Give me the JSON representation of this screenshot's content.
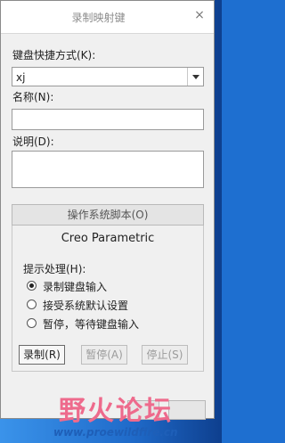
{
  "window": {
    "title": "录制映射键",
    "close_glyph": "×"
  },
  "form": {
    "key_sequence": {
      "label": "键盘快捷方式(K):",
      "value": "xj"
    },
    "name": {
      "label": "名称(N):",
      "value": ""
    },
    "description": {
      "label": "说明(D):",
      "value": ""
    }
  },
  "script_section": {
    "tab_label": "操作系统脚本(O)",
    "app_label": "Creo Parametric",
    "prompt_label": "提示处理(H):",
    "options": [
      {
        "label": "录制键盘输入",
        "selected": true
      },
      {
        "label": "接受系统默认设置",
        "selected": false
      },
      {
        "label": "暂停，等待键盘输入",
        "selected": false
      }
    ],
    "buttons": {
      "record": "录制(R)",
      "pause": "暂停(A)",
      "stop": "停止(S)"
    }
  },
  "watermark": {
    "text": "野火论坛",
    "url": "www.proewildfire.cn"
  }
}
